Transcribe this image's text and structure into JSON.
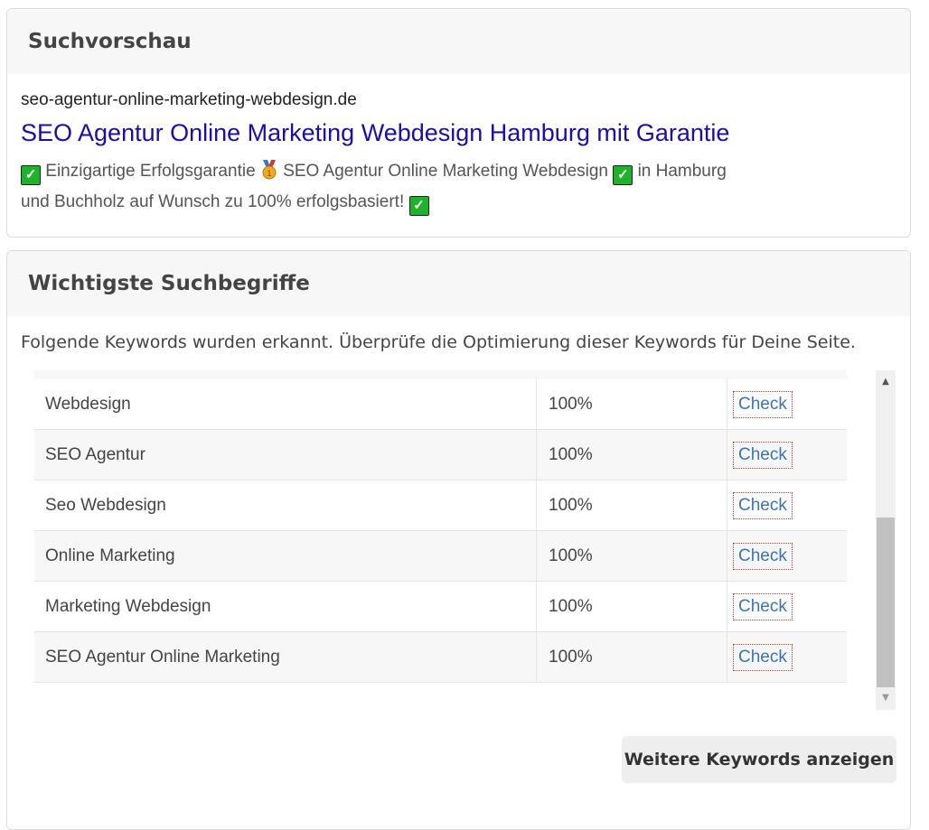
{
  "search_preview": {
    "heading": "Suchvorschau",
    "url": "seo-agentur-online-marketing-webdesign.de",
    "title": "SEO Agentur Online Marketing Webdesign Hamburg mit Garantie",
    "desc_1": "Einzigartige Erfolgsgarantie",
    "desc_2": "SEO Agentur Online Marketing Webdesign",
    "desc_3": "in Hamburg und Buchholz auf Wunsch zu 100% erfolgsbasiert!"
  },
  "keywords": {
    "heading": "Wichtigste Suchbegriffe",
    "intro": "Folgende Keywords wurden erkannt. Überprüfe die Optimierung dieser Keywords für Deine Seite.",
    "rows": [
      {
        "keyword": "Webdesign",
        "percent": "100%",
        "action": "Check"
      },
      {
        "keyword": "SEO Agentur",
        "percent": "100%",
        "action": "Check"
      },
      {
        "keyword": "Seo Webdesign",
        "percent": "100%",
        "action": "Check"
      },
      {
        "keyword": "Online Marketing",
        "percent": "100%",
        "action": "Check"
      },
      {
        "keyword": "Marketing Webdesign",
        "percent": "100%",
        "action": "Check"
      },
      {
        "keyword": "SEO Agentur Online Marketing",
        "percent": "100%",
        "action": "Check"
      }
    ],
    "more_button": "Weitere Keywords anzeigen"
  },
  "icons": {
    "checkmark": "check-mark-icon",
    "medal": "medal-icon"
  },
  "colors": {
    "title_link": "#1a0dab",
    "check_link": "#3a73b5",
    "checkmark_bg": "#1fb32c"
  }
}
